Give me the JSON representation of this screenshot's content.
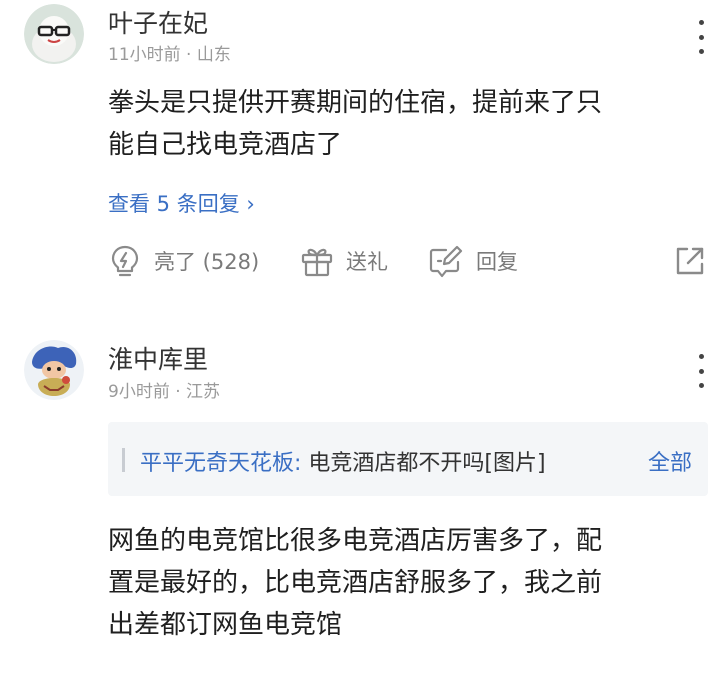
{
  "comments": [
    {
      "username": "叶子在妃",
      "meta": "11小时前 · 山东",
      "content_lines": [
        "拳头是只提供开赛期间的住宿，提前来了只",
        "能自己找电竞酒店了"
      ],
      "replies_link": "查看 5 条回复 ›",
      "actions": {
        "like_label": "亮了 (528)",
        "gift_label": "送礼",
        "reply_label": "回复"
      }
    },
    {
      "username": "淮中库里",
      "meta": "9小时前 · 江苏",
      "quote": {
        "author": "平平无奇天花板:",
        "text": "电竞酒店都不开吗[图片]",
        "all_label": "全部"
      },
      "content_lines": [
        "网鱼的电竞馆比很多电竞酒店厉害多了，配",
        "置是最好的，比电竞酒店舒服多了，我之前",
        "出差都订网鱼电竞馆"
      ]
    }
  ],
  "icons": [
    "like-bulb-icon",
    "gift-icon",
    "reply-edit-icon",
    "share-icon",
    "more-icon"
  ],
  "colors": {
    "link": "#3a6fc4",
    "meta": "#9a9a9a",
    "icon": "#8a8a8a",
    "quote_bg": "#f4f6f8"
  }
}
